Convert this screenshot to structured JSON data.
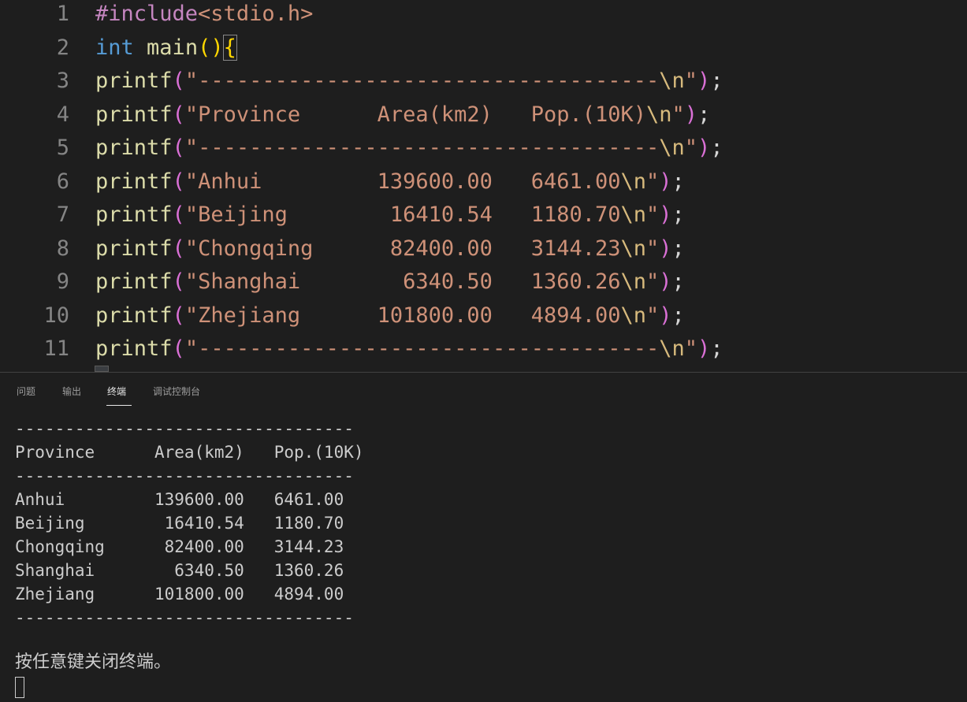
{
  "editor": {
    "lines": [
      {
        "num": "1",
        "tokens": [
          {
            "t": "#include",
            "c": "pre"
          },
          {
            "t": "<stdio.h>",
            "c": "str"
          }
        ]
      },
      {
        "num": "2",
        "tokens": [
          {
            "t": "int",
            "c": "kw"
          },
          {
            "t": " ",
            "c": "punc"
          },
          {
            "t": "main",
            "c": "fn"
          },
          {
            "t": "()",
            "c": "paren"
          },
          {
            "t": "{",
            "c": "paren",
            "box": true
          }
        ]
      },
      {
        "num": "3",
        "tokens": [
          {
            "t": "printf",
            "c": "fn"
          },
          {
            "t": "(",
            "c": "brace"
          },
          {
            "t": "\"------------------------------------",
            "c": "str"
          },
          {
            "t": "\\n",
            "c": "esc"
          },
          {
            "t": "\"",
            "c": "str"
          },
          {
            "t": ")",
            "c": "brace"
          },
          {
            "t": ";",
            "c": "punc"
          }
        ]
      },
      {
        "num": "4",
        "tokens": [
          {
            "t": "printf",
            "c": "fn"
          },
          {
            "t": "(",
            "c": "brace"
          },
          {
            "t": "\"Province      Area(km2)   Pop.(10K)",
            "c": "str"
          },
          {
            "t": "\\n",
            "c": "esc"
          },
          {
            "t": "\"",
            "c": "str"
          },
          {
            "t": ")",
            "c": "brace"
          },
          {
            "t": ";",
            "c": "punc"
          }
        ]
      },
      {
        "num": "5",
        "tokens": [
          {
            "t": "printf",
            "c": "fn"
          },
          {
            "t": "(",
            "c": "brace"
          },
          {
            "t": "\"------------------------------------",
            "c": "str"
          },
          {
            "t": "\\n",
            "c": "esc"
          },
          {
            "t": "\"",
            "c": "str"
          },
          {
            "t": ")",
            "c": "brace"
          },
          {
            "t": ";",
            "c": "punc"
          }
        ]
      },
      {
        "num": "6",
        "tokens": [
          {
            "t": "printf",
            "c": "fn"
          },
          {
            "t": "(",
            "c": "brace"
          },
          {
            "t": "\"Anhui         139600.00   6461.00",
            "c": "str"
          },
          {
            "t": "\\n",
            "c": "esc"
          },
          {
            "t": "\"",
            "c": "str"
          },
          {
            "t": ")",
            "c": "brace"
          },
          {
            "t": ";",
            "c": "punc"
          }
        ]
      },
      {
        "num": "7",
        "tokens": [
          {
            "t": "printf",
            "c": "fn"
          },
          {
            "t": "(",
            "c": "brace"
          },
          {
            "t": "\"Beijing        16410.54   1180.70",
            "c": "str"
          },
          {
            "t": "\\n",
            "c": "esc"
          },
          {
            "t": "\"",
            "c": "str"
          },
          {
            "t": ")",
            "c": "brace"
          },
          {
            "t": ";",
            "c": "punc"
          }
        ]
      },
      {
        "num": "8",
        "tokens": [
          {
            "t": "printf",
            "c": "fn"
          },
          {
            "t": "(",
            "c": "brace"
          },
          {
            "t": "\"Chongqing      82400.00   3144.23",
            "c": "str"
          },
          {
            "t": "\\n",
            "c": "esc"
          },
          {
            "t": "\"",
            "c": "str"
          },
          {
            "t": ")",
            "c": "brace"
          },
          {
            "t": ";",
            "c": "punc"
          }
        ]
      },
      {
        "num": "9",
        "tokens": [
          {
            "t": "printf",
            "c": "fn"
          },
          {
            "t": "(",
            "c": "brace"
          },
          {
            "t": "\"Shanghai        6340.50   1360.26",
            "c": "str"
          },
          {
            "t": "\\n",
            "c": "esc"
          },
          {
            "t": "\"",
            "c": "str"
          },
          {
            "t": ")",
            "c": "brace"
          },
          {
            "t": ";",
            "c": "punc"
          }
        ]
      },
      {
        "num": "10",
        "tokens": [
          {
            "t": "printf",
            "c": "fn"
          },
          {
            "t": "(",
            "c": "brace"
          },
          {
            "t": "\"Zhejiang      101800.00   4894.00",
            "c": "str"
          },
          {
            "t": "\\n",
            "c": "esc"
          },
          {
            "t": "\"",
            "c": "str"
          },
          {
            "t": ")",
            "c": "brace"
          },
          {
            "t": ";",
            "c": "punc"
          }
        ]
      },
      {
        "num": "11",
        "tokens": [
          {
            "t": "printf",
            "c": "fn"
          },
          {
            "t": "(",
            "c": "brace"
          },
          {
            "t": "\"------------------------------------",
            "c": "str"
          },
          {
            "t": "\\n",
            "c": "esc"
          },
          {
            "t": "\"",
            "c": "str"
          },
          {
            "t": ")",
            "c": "brace"
          },
          {
            "t": ";",
            "c": "punc"
          }
        ]
      }
    ]
  },
  "panel": {
    "tabs": [
      "问题",
      "输出",
      "终端",
      "调试控制台"
    ],
    "active_tab": "终端",
    "terminal": {
      "lines": [
        "----------------------------------",
        "Province      Area(km2)   Pop.(10K)",
        "----------------------------------",
        "Anhui         139600.00   6461.00",
        "Beijing        16410.54   1180.70",
        "Chongqing      82400.00   3144.23",
        "Shanghai        6340.50   1360.26",
        "Zhejiang      101800.00   4894.00",
        "----------------------------------"
      ],
      "message": "按任意键关闭终端。"
    }
  },
  "colors": {
    "background": "#1e1e1e",
    "string": "#ce9178",
    "function": "#dcdcaa",
    "keyword": "#569cd6",
    "preprocessor": "#c586c0",
    "bracket_gold": "#ffd700",
    "bracket_orchid": "#da70d6"
  }
}
